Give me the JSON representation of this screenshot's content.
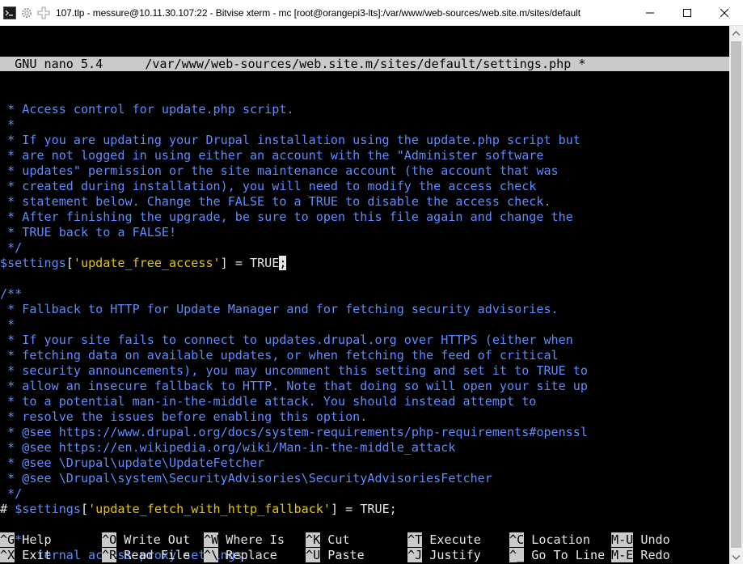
{
  "window": {
    "title": "107.tlp - messure@10.11.30.107:22 - Bitvise xterm - mc [root@orangepi3-lts]:/var/www/web-sources/web.site.m/sites/default"
  },
  "editor": {
    "header_left": "  GNU nano 5.4",
    "header_file": "/var/www/web-sources/web.site.m/sites/default/settings.php *",
    "lines": [
      [
        {
          "t": " * Access control for update.php script.",
          "c": "comment"
        }
      ],
      [
        {
          "t": " *",
          "c": "comment"
        }
      ],
      [
        {
          "t": " * If you are updating your Drupal installation using the update.php script but",
          "c": "comment"
        }
      ],
      [
        {
          "t": " * are not logged in using either an account with the \"Administer software",
          "c": "comment"
        }
      ],
      [
        {
          "t": " * updates\" permission or the site maintenance account (the account that was",
          "c": "comment"
        }
      ],
      [
        {
          "t": " * created during installation), you will need to modify the access check",
          "c": "comment"
        }
      ],
      [
        {
          "t": " * statement below. Change the FALSE to a TRUE to disable the access check.",
          "c": "comment"
        }
      ],
      [
        {
          "t": " * After finishing the upgrade, be sure to open this file again and change the",
          "c": "comment"
        }
      ],
      [
        {
          "t": " * TRUE back to a FALSE!",
          "c": "comment"
        }
      ],
      [
        {
          "t": " */",
          "c": "comment"
        }
      ],
      [
        {
          "t": "$settings",
          "c": "var"
        },
        {
          "t": "[",
          "c": "text"
        },
        {
          "t": "'update_free_access'",
          "c": "str"
        },
        {
          "t": "] = TRUE",
          "c": "text"
        },
        {
          "t": ";",
          "c": "cursor"
        }
      ],
      [
        {
          "t": "",
          "c": "text"
        }
      ],
      [
        {
          "t": "/**",
          "c": "comment"
        }
      ],
      [
        {
          "t": " * Fallback to HTTP for Update Manager and for fetching security advisories.",
          "c": "comment"
        }
      ],
      [
        {
          "t": " *",
          "c": "comment"
        }
      ],
      [
        {
          "t": " * If your site fails to connect to updates.drupal.org over HTTPS (either when",
          "c": "comment"
        }
      ],
      [
        {
          "t": " * fetching data on available updates, or when fetching the feed of critical",
          "c": "comment"
        }
      ],
      [
        {
          "t": " * security announcements), you may uncomment this setting and set it to TRUE to",
          "c": "comment"
        }
      ],
      [
        {
          "t": " * allow an insecure fallback to HTTP. Note that doing so will open your site up",
          "c": "comment"
        }
      ],
      [
        {
          "t": " * to a potential man-in-the-middle attack. You should instead attempt to",
          "c": "comment"
        }
      ],
      [
        {
          "t": " * resolve the issues before enabling this option.",
          "c": "comment"
        }
      ],
      [
        {
          "t": " * @see https://www.drupal.org/docs/system-requirements/php-requirements#openssl",
          "c": "comment"
        }
      ],
      [
        {
          "t": " * @see https://en.wikipedia.org/wiki/Man-in-the-middle_attack",
          "c": "comment"
        }
      ],
      [
        {
          "t": " * @see \\Drupal\\update\\UpdateFetcher",
          "c": "comment"
        }
      ],
      [
        {
          "t": " * @see \\Drupal\\system\\SecurityAdvisories\\SecurityAdvisoriesFetcher",
          "c": "comment"
        }
      ],
      [
        {
          "t": " */",
          "c": "comment"
        }
      ],
      [
        {
          "t": "# ",
          "c": "text"
        },
        {
          "t": "$settings",
          "c": "var"
        },
        {
          "t": "[",
          "c": "text"
        },
        {
          "t": "'update_fetch_with_http_fallback'",
          "c": "str"
        },
        {
          "t": "] = TRUE;",
          "c": "text"
        }
      ],
      [
        {
          "t": "",
          "c": "text"
        }
      ],
      [
        {
          "t": "/**",
          "c": "comment"
        }
      ],
      [
        {
          "t": " * External access proxy settings:",
          "c": "comment"
        }
      ],
      [
        {
          "t": " *",
          "c": "comment"
        }
      ]
    ]
  },
  "shortcuts": [
    {
      "key": "^G",
      "label": "Help",
      "col": 0,
      "row": 0
    },
    {
      "key": "^X",
      "label": "Exit",
      "col": 0,
      "row": 1
    },
    {
      "key": "^O",
      "label": "Write Out",
      "col": 1,
      "row": 0
    },
    {
      "key": "^R",
      "label": "Read File",
      "col": 1,
      "row": 1
    },
    {
      "key": "^W",
      "label": "Where Is",
      "col": 2,
      "row": 0
    },
    {
      "key": "^\\",
      "label": "Replace",
      "col": 2,
      "row": 1
    },
    {
      "key": "^K",
      "label": "Cut",
      "col": 3,
      "row": 0
    },
    {
      "key": "^U",
      "label": "Paste",
      "col": 3,
      "row": 1
    },
    {
      "key": "^T",
      "label": "Execute",
      "col": 4,
      "row": 0
    },
    {
      "key": "^J",
      "label": "Justify",
      "col": 4,
      "row": 1
    },
    {
      "key": "^C",
      "label": "Location",
      "col": 5,
      "row": 0
    },
    {
      "key": "^_",
      "label": "Go To Line",
      "col": 5,
      "row": 1
    },
    {
      "key": "M-U",
      "label": "Undo",
      "col": 6,
      "row": 0
    },
    {
      "key": "M-E",
      "label": "Redo",
      "col": 6,
      "row": 1
    }
  ],
  "colors": {
    "comment": "#5c8cff",
    "string": "#e6c600",
    "text": "#e6e6e6",
    "header_bg": "#cacaca"
  }
}
